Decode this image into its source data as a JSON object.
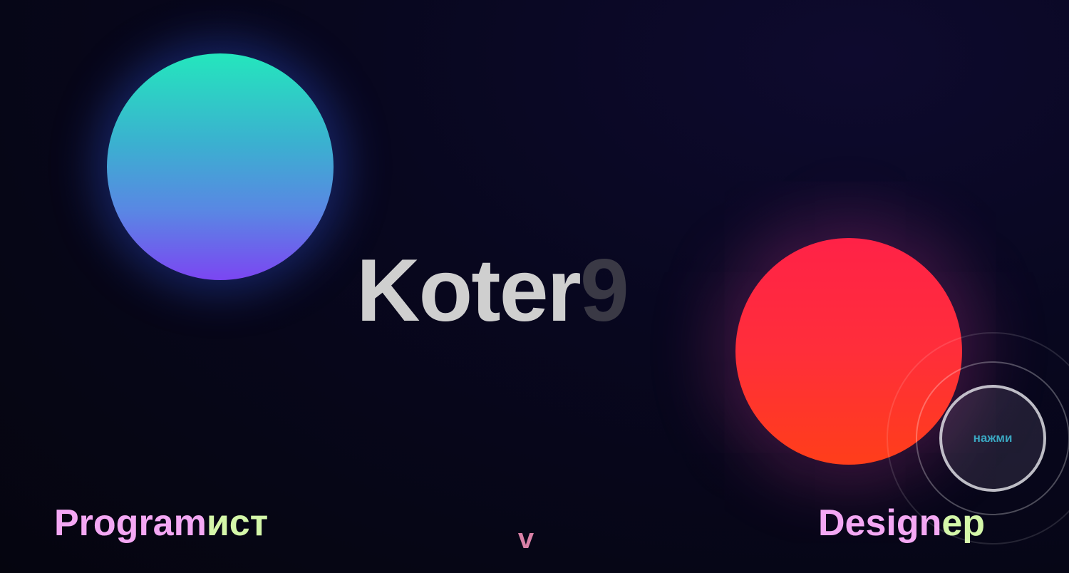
{
  "brand": {
    "main": "Koter",
    "tail": "9"
  },
  "labels": {
    "left": {
      "part1": "Program",
      "part2": "ист"
    },
    "right": {
      "part1": "Design",
      "part2": "ер"
    }
  },
  "scroll_indicator": {
    "glyph": "v"
  },
  "press_button": {
    "label": "нажми"
  },
  "colors": {
    "background": "#08071f",
    "orb_left_top": "#24e6bd",
    "orb_left_bottom": "#7b46f2",
    "orb_right_top": "#ff2247",
    "orb_right_bottom": "#ff3e1a",
    "label_pink": "#f4a8f4",
    "label_green": "#d4f7a9",
    "brand_main": "#cfcfcf",
    "brand_tail": "#3a3945",
    "scroll_glyph": "#d880a6",
    "press_label": "#3aa6c0"
  }
}
